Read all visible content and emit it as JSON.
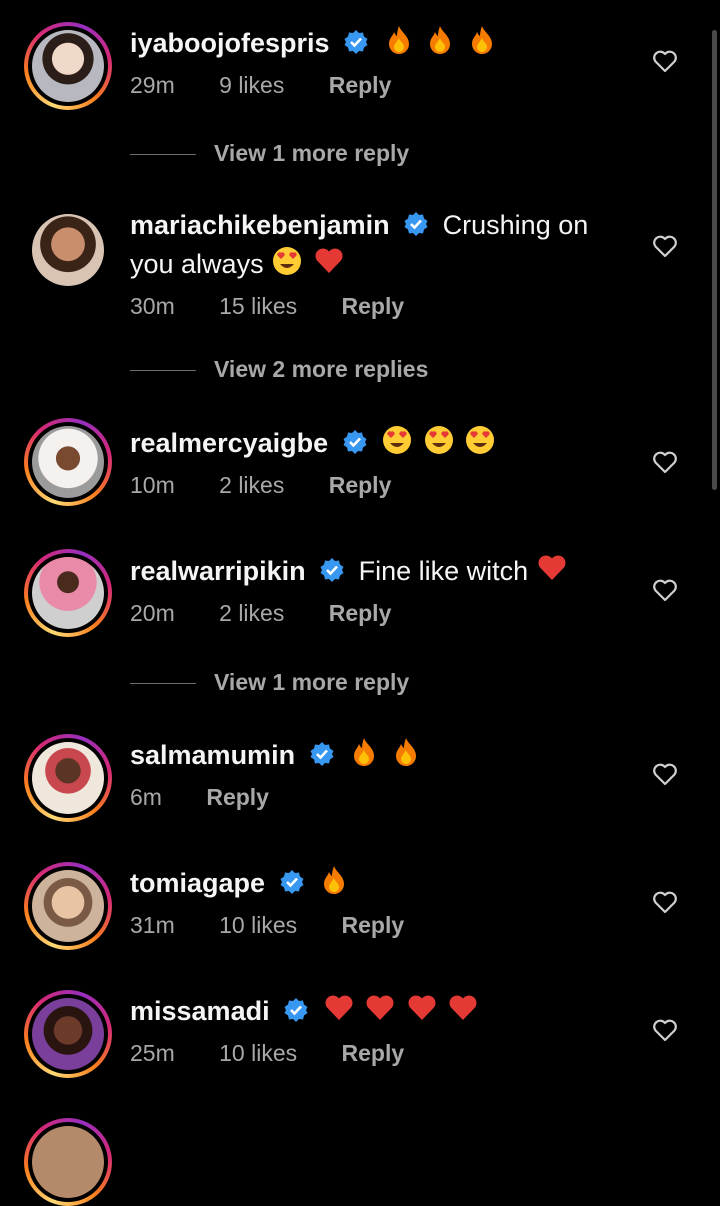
{
  "comments": [
    {
      "username": "iyaboojofespris",
      "text": "",
      "emoji": [
        "fire",
        "fire",
        "fire"
      ],
      "time": "29m",
      "likes": "9 likes",
      "reply": "Reply",
      "ring": true,
      "avatar_bg": "#cfcfcf"
    },
    {
      "username": "mariachikebenjamin",
      "text": "Crushing on",
      "text2": "you always",
      "emoji": [
        "heart-eyes",
        "red-heart"
      ],
      "time": "30m",
      "likes": "15 likes",
      "reply": "Reply",
      "ring": false,
      "avatar_bg": "#b37a58"
    },
    {
      "username": "realmercyaigbe",
      "text": "",
      "emoji": [
        "heart-eyes",
        "heart-eyes",
        "heart-eyes"
      ],
      "time": "10m",
      "likes": "2 likes",
      "reply": "Reply",
      "ring": true,
      "avatar_bg": "#e8e2df"
    },
    {
      "username": "realwarripikin",
      "text": "Fine like witch",
      "emoji": [
        "red-heart"
      ],
      "time": "20m",
      "likes": "2 likes",
      "reply": "Reply",
      "ring": true,
      "avatar_bg": "#d9d9d9"
    },
    {
      "username": "salmamumin",
      "text": "",
      "emoji": [
        "fire",
        "fire"
      ],
      "time": "6m",
      "likes": "",
      "reply": "Reply",
      "ring": true,
      "avatar_bg": "#d8c9b4"
    },
    {
      "username": "tomiagape",
      "text": "",
      "emoji": [
        "fire"
      ],
      "time": "31m",
      "likes": "10 likes",
      "reply": "Reply",
      "ring": true,
      "avatar_bg": "#caa88a"
    },
    {
      "username": "missamadi",
      "text": "",
      "emoji": [
        "red-heart",
        "red-heart",
        "red-heart",
        "red-heart"
      ],
      "time": "25m",
      "likes": "10 likes",
      "reply": "Reply",
      "ring": true,
      "avatar_bg": "#6b3b8a"
    }
  ],
  "view_more": [
    "View 1 more reply",
    "View 2 more replies",
    "View 1 more reply"
  ],
  "colors": {
    "verified": "#3897f0",
    "meta": "#a8a8a8",
    "ring_gradient": [
      "#feda75",
      "#fa7e1e",
      "#d62976",
      "#962fbf"
    ]
  },
  "icons": {
    "verified": "verified-badge-icon",
    "like": "heart-outline-icon"
  }
}
